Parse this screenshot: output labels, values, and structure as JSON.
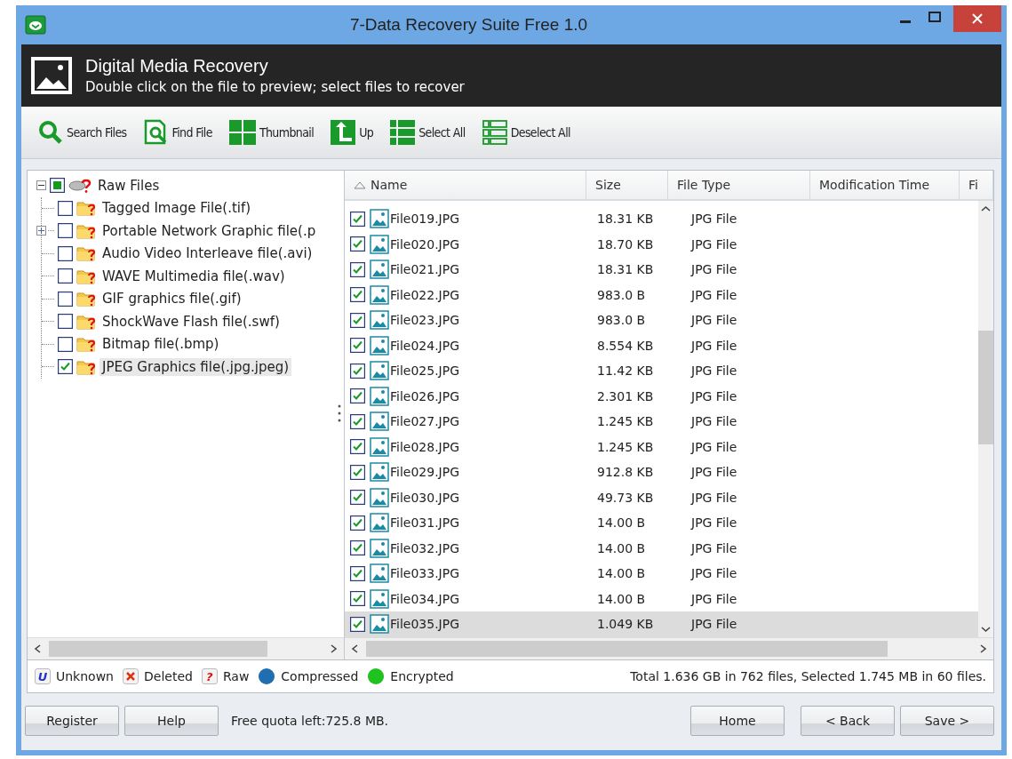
{
  "window": {
    "title": "7-Data Recovery Suite Free 1.0"
  },
  "header": {
    "title": "Digital Media Recovery",
    "subtitle": "Double click on the file to preview; select files to recover"
  },
  "toolbar": [
    {
      "kind": "search",
      "label": "Search Files"
    },
    {
      "kind": "find",
      "label": "Find File"
    },
    {
      "kind": "thumbnail",
      "label": "Thumbnail"
    },
    {
      "kind": "up",
      "label": "Up"
    },
    {
      "kind": "selectall",
      "label": "Select All"
    },
    {
      "kind": "deselectall",
      "label": "Deselect All"
    }
  ],
  "tree": {
    "label": "Raw Files",
    "expanded": true,
    "partial": true,
    "children": [
      {
        "label": "Tagged Image File(.tif)",
        "checked": false,
        "selected": false,
        "expandable": false
      },
      {
        "label": "Portable Network Graphic file(.p",
        "checked": false,
        "selected": false,
        "expandable": true
      },
      {
        "label": "Audio Video Interleave file(.avi)",
        "checked": false,
        "selected": false,
        "expandable": false
      },
      {
        "label": "WAVE Multimedia file(.wav)",
        "checked": false,
        "selected": false,
        "expandable": false
      },
      {
        "label": "GIF graphics file(.gif)",
        "checked": false,
        "selected": false,
        "expandable": false
      },
      {
        "label": "ShockWave Flash file(.swf)",
        "checked": false,
        "selected": false,
        "expandable": false
      },
      {
        "label": "Bitmap file(.bmp)",
        "checked": false,
        "selected": false,
        "expandable": false
      },
      {
        "label": "JPEG Graphics file(.jpg.jpeg)",
        "checked": true,
        "selected": true,
        "expandable": false
      }
    ]
  },
  "table": {
    "columns": [
      {
        "label": "Name",
        "sorted": true
      },
      {
        "label": "Size",
        "sorted": false
      },
      {
        "label": "File Type",
        "sorted": false
      },
      {
        "label": "Modification Time",
        "sorted": false
      },
      {
        "label": "Fi",
        "sorted": false
      }
    ],
    "rows": [
      {
        "name": "File019.JPG",
        "size": "18.31 KB",
        "type": "JPG File",
        "checked": true,
        "selected": false
      },
      {
        "name": "File020.JPG",
        "size": "18.70 KB",
        "type": "JPG File",
        "checked": true,
        "selected": false
      },
      {
        "name": "File021.JPG",
        "size": "18.31 KB",
        "type": "JPG File",
        "checked": true,
        "selected": false
      },
      {
        "name": "File022.JPG",
        "size": "983.0 B",
        "type": "JPG File",
        "checked": true,
        "selected": false
      },
      {
        "name": "File023.JPG",
        "size": "983.0 B",
        "type": "JPG File",
        "checked": true,
        "selected": false
      },
      {
        "name": "File024.JPG",
        "size": "8.554 KB",
        "type": "JPG File",
        "checked": true,
        "selected": false
      },
      {
        "name": "File025.JPG",
        "size": "11.42 KB",
        "type": "JPG File",
        "checked": true,
        "selected": false
      },
      {
        "name": "File026.JPG",
        "size": "2.301 KB",
        "type": "JPG File",
        "checked": true,
        "selected": false
      },
      {
        "name": "File027.JPG",
        "size": "1.245 KB",
        "type": "JPG File",
        "checked": true,
        "selected": false
      },
      {
        "name": "File028.JPG",
        "size": "1.245 KB",
        "type": "JPG File",
        "checked": true,
        "selected": false
      },
      {
        "name": "File029.JPG",
        "size": "912.8 KB",
        "type": "JPG File",
        "checked": true,
        "selected": false
      },
      {
        "name": "File030.JPG",
        "size": "49.73 KB",
        "type": "JPG File",
        "checked": true,
        "selected": false
      },
      {
        "name": "File031.JPG",
        "size": "14.00 B",
        "type": "JPG File",
        "checked": true,
        "selected": false
      },
      {
        "name": "File032.JPG",
        "size": "14.00 B",
        "type": "JPG File",
        "checked": true,
        "selected": false
      },
      {
        "name": "File033.JPG",
        "size": "14.00 B",
        "type": "JPG File",
        "checked": true,
        "selected": false
      },
      {
        "name": "File034.JPG",
        "size": "14.00 B",
        "type": "JPG File",
        "checked": true,
        "selected": false
      },
      {
        "name": "File035.JPG",
        "size": "1.049 KB",
        "type": "JPG File",
        "checked": true,
        "selected": true
      }
    ]
  },
  "legend": [
    {
      "kind": "letter",
      "symbol": "U",
      "label": "Unknown"
    },
    {
      "kind": "cross",
      "label": "Deleted"
    },
    {
      "kind": "letter",
      "symbol": "?",
      "label": "Raw"
    },
    {
      "kind": "ball",
      "color": "#1f6fb0",
      "label": "Compressed"
    },
    {
      "kind": "ball",
      "color": "#1fc21f",
      "label": "Encrypted"
    }
  ],
  "summary": "Total 1.636 GB in 762 files, Selected 1.745 MB in 60 files.",
  "bottom": {
    "left_buttons": [
      "Register",
      "Help"
    ],
    "quota": "Free quota left:725.8 MB.",
    "right_buttons": [
      "Home",
      "< Back",
      "Save >"
    ]
  }
}
